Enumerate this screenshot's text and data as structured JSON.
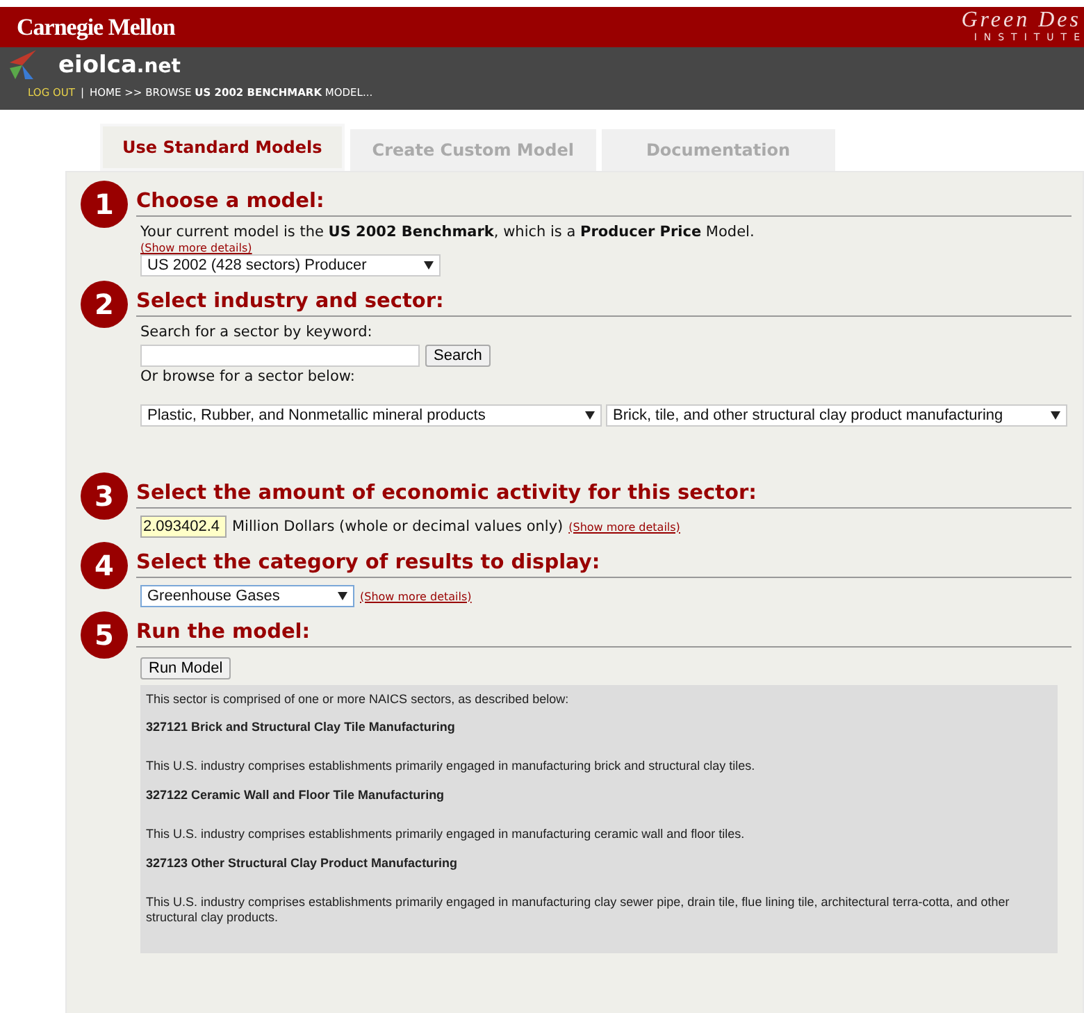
{
  "header": {
    "university": "Carnegie Mellon",
    "institute_script": "Green Des",
    "institute_caption": "INSTITUTE",
    "site_name": "eiolca",
    "site_suffix": ".net",
    "logout": "LOG OUT",
    "separator": "|",
    "trail": "HOME >> BROWSE **US 2002 BENCHMARK** MODEL..."
  },
  "tabs": [
    {
      "label": "Use Standard Models",
      "selected": true
    },
    {
      "label": "Create Custom Model",
      "selected": false
    },
    {
      "label": "Documentation",
      "selected": false
    }
  ],
  "steps": [
    {
      "kind": "model",
      "number": "1",
      "title": "Choose a model:",
      "text": "Your current model is the **US 2002 Benchmark**, which is a **Producer Price** Model.",
      "details_link": "(Show more details)",
      "select": "US 2002 (428 sectors) Producer"
    },
    {
      "kind": "sector",
      "number": "2",
      "title": "Select industry and sector:",
      "search_label": "Search for a sector by keyword:",
      "search_button": "Search",
      "browse_label": "Or browse for a sector below:",
      "selects": [
        "Plastic, Rubber, and Nonmetallic mineral products",
        "Brick, tile, and other structural clay product manufacturing"
      ]
    },
    {
      "kind": "amount",
      "number": "3",
      "title": "Select the amount of economic activity for this sector:",
      "amount": "2.093402.4",
      "unit_text": "Million Dollars (whole or decimal values only)",
      "details_link": "(Show more details)"
    },
    {
      "kind": "category",
      "number": "4",
      "title": "Select the category of results to display:",
      "select": "Greenhouse Gases",
      "details_link": "(Show more details)"
    },
    {
      "kind": "run",
      "number": "5",
      "title": "Run the model:",
      "run_button": "Run Model",
      "intro": "This sector is comprised of one or more NAICS sectors, as described below:",
      "sectors": [
        {
          "title": "327121 Brick and Structural Clay Tile Manufacturing",
          "description": "This U.S. industry comprises establishments primarily engaged in manufacturing brick and structural clay tiles."
        },
        {
          "title": "327122 Ceramic Wall and Floor Tile Manufacturing",
          "description": "This U.S. industry comprises establishments primarily engaged in manufacturing ceramic wall and floor tiles."
        },
        {
          "title": "327123 Other Structural Clay Product Manufacturing",
          "description": "This U.S. industry comprises establishments primarily engaged in manufacturing clay sewer pipe, drain tile, flue lining tile, architectural terra-cotta, and other structural clay products."
        }
      ]
    }
  ]
}
